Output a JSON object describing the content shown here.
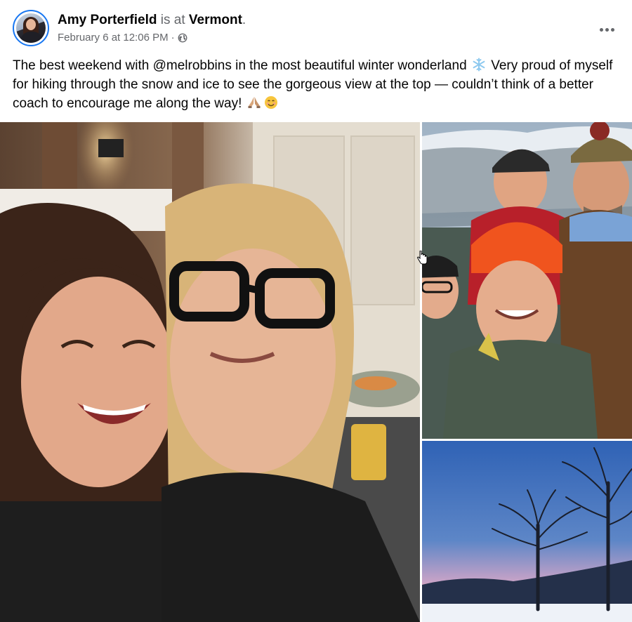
{
  "post": {
    "author": "Amy Porterfield",
    "location_prefix": " is at ",
    "location": "Vermont",
    "location_suffix": ".",
    "timestamp": "February 6 at 12:06 PM",
    "separator": "·",
    "privacy_icon": "globe-icon",
    "more_icon": "more-options-icon",
    "caption_part1": "The best weekend with @melrobbins in the most beautiful winter wonderland",
    "caption_part2": "Very proud of myself for hiking through the snow and ice to see the gorgeous view at the top — couldn’t think of a better coach to encourage me along the way!",
    "caption_emojis": [
      "snowflake-emoji",
      "folded-hands-emoji",
      "smiling-face-emoji"
    ]
  },
  "photos": {
    "main": "selfie-photo",
    "top_right": "hiking-group-photo",
    "bottom_right": "winter-sunset-photo"
  },
  "colors": {
    "link_blue": "#1877f2",
    "muted_text": "#65676b",
    "text": "#050505",
    "snowflake": "#8ec9ef"
  }
}
